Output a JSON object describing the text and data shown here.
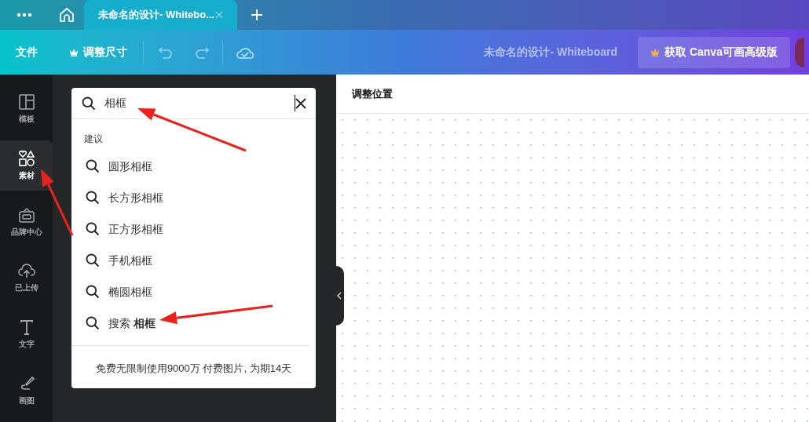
{
  "tab_bar": {
    "tabs": [
      {
        "title": "未命名的设计- Whitebo...",
        "selected": true
      }
    ]
  },
  "toolbar": {
    "file_menu": "文件",
    "resize": "调整尺寸",
    "document_title": "未命名的设计- Whiteboard",
    "upgrade_button": "获取 Canva可画高级版"
  },
  "sidebar": {
    "items": [
      {
        "kind": "templates",
        "label": "模板",
        "selected": false
      },
      {
        "kind": "elements",
        "label": "素材",
        "selected": true
      },
      {
        "kind": "brand",
        "label": "品牌中心",
        "selected": false
      },
      {
        "kind": "uploads",
        "label": "已上传",
        "selected": false
      },
      {
        "kind": "text",
        "label": "文字",
        "selected": false
      },
      {
        "kind": "draw",
        "label": "画图",
        "selected": false
      }
    ]
  },
  "search": {
    "value": "相框",
    "heading": "建议",
    "suggestions": [
      "圆形相框",
      "长方形相框",
      "正方形相框",
      "手机相框",
      "椭圆相框",
      "搜索 **相框**"
    ],
    "footer_note": "免费无限制使用9000万 付费图片, 为期14天"
  },
  "canvas": {
    "header": "调整位置"
  }
}
